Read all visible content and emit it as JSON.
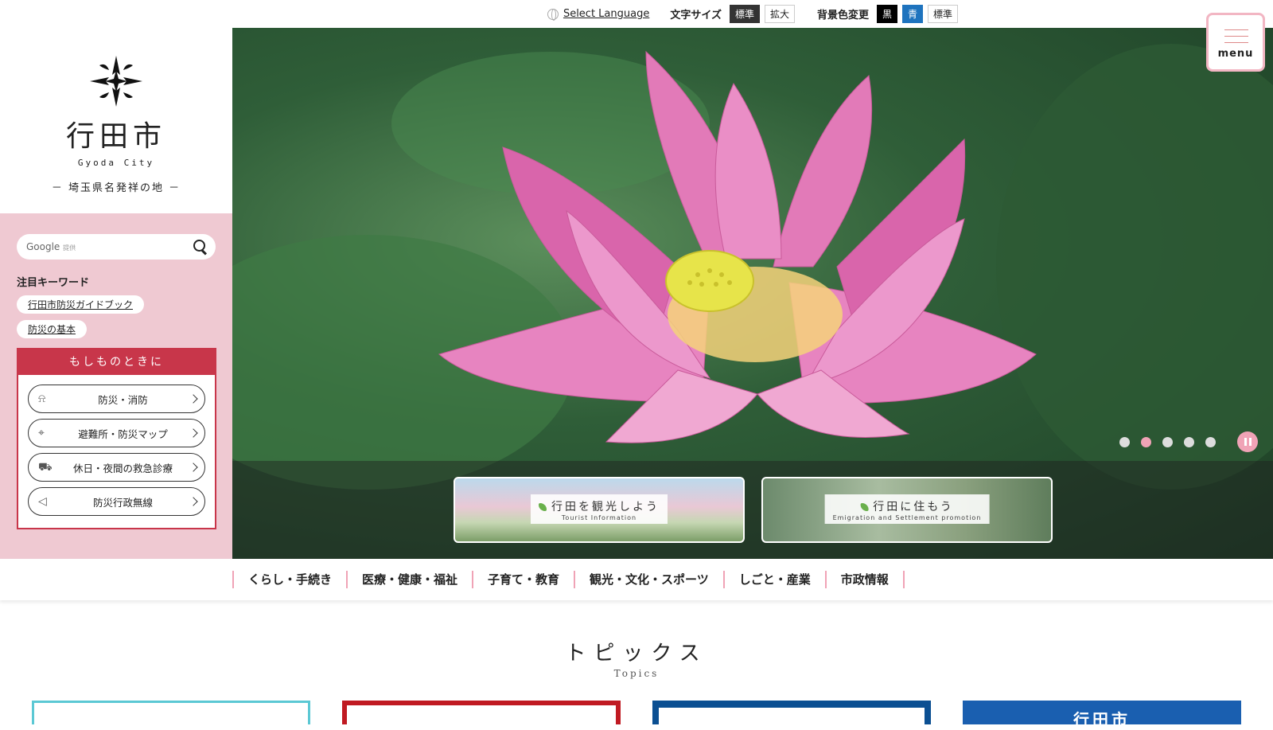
{
  "utility": {
    "select_language": "Select Language",
    "font_size_label": "文字サイズ",
    "font_size_options": [
      "標準",
      "拡大"
    ],
    "bg_color_label": "背景色変更",
    "bg_color_options": [
      "黒",
      "青",
      "標準"
    ]
  },
  "menu_button": {
    "label": "menu"
  },
  "header": {
    "city_name": "行田市",
    "city_name_en": "Gyoda City",
    "tagline": "－ 埼玉県名発祥の地 －"
  },
  "search": {
    "placeholder": "Google",
    "provided": "提供"
  },
  "keywords": {
    "title": "注目キーワード",
    "items": [
      "行田市防災ガイドブック",
      "防災の基本"
    ]
  },
  "emergency": {
    "title": "もしものときに",
    "items": [
      {
        "label": "防災・消防",
        "icon": "alarm-icon"
      },
      {
        "label": "避難所・防災マップ",
        "icon": "map-pin-icon"
      },
      {
        "label": "休日・夜間の救急診療",
        "icon": "ambulance-icon"
      },
      {
        "label": "防災行政無線",
        "icon": "megaphone-icon"
      }
    ]
  },
  "hero": {
    "banners": [
      {
        "title": "行田を観光しよう",
        "subtitle": "Tourist Information"
      },
      {
        "title": "行田に住もう",
        "subtitle": "Emigration and Settlement promotion"
      }
    ],
    "slides_count": 5,
    "active_slide": 2
  },
  "nav": {
    "items": [
      "くらし・手続き",
      "医療・健康・福祉",
      "子育て・教育",
      "観光・文化・スポーツ",
      "しごと・産業",
      "市政情報"
    ]
  },
  "topics": {
    "title": "トピックス",
    "title_en": "Topics",
    "card4_text": "行田市"
  },
  "colors": {
    "accent_pink": "#efc9d2",
    "emergency_red": "#c8364a",
    "nav_divider": "#f0a3b6"
  }
}
